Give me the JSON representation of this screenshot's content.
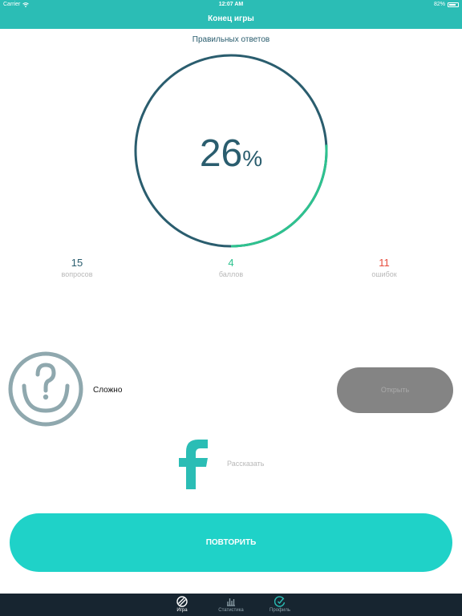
{
  "status_bar": {
    "carrier": "Carrier",
    "time": "12:07 AM",
    "battery": "82%",
    "battery_level": 0.82
  },
  "nav": {
    "title": "Конец игры"
  },
  "result": {
    "title": "Правильных ответов",
    "percent_value": "26",
    "percent_sign": "%",
    "progress": 0.26,
    "colors": {
      "track": "#2a5d6e",
      "progress": "#2ec28f"
    }
  },
  "stats": [
    {
      "value": "15",
      "label": "вопросов",
      "color": "#2a5d6e"
    },
    {
      "value": "4",
      "label": "баллов",
      "color": "#2ec28f"
    },
    {
      "value": "11",
      "label": "ошибок",
      "color": "#e74c3c"
    }
  ],
  "difficulty": {
    "label": "Сложно",
    "icon": "question-smiley-icon"
  },
  "open_button": {
    "label": "Открыть"
  },
  "share": {
    "label": "Рассказать",
    "icon": "facebook-icon"
  },
  "repeat_button": {
    "label": "ПОВТОРИТЬ"
  },
  "tabs": [
    {
      "label": "Игра",
      "icon": "ball-icon",
      "active": true
    },
    {
      "label": "Статистика",
      "icon": "stats-icon",
      "active": false
    },
    {
      "label": "Профиль",
      "icon": "profile-icon",
      "active": false
    }
  ],
  "colors": {
    "accent": "#2bbdb5",
    "button": "#1fd2c8",
    "tabbar": "#172530"
  }
}
